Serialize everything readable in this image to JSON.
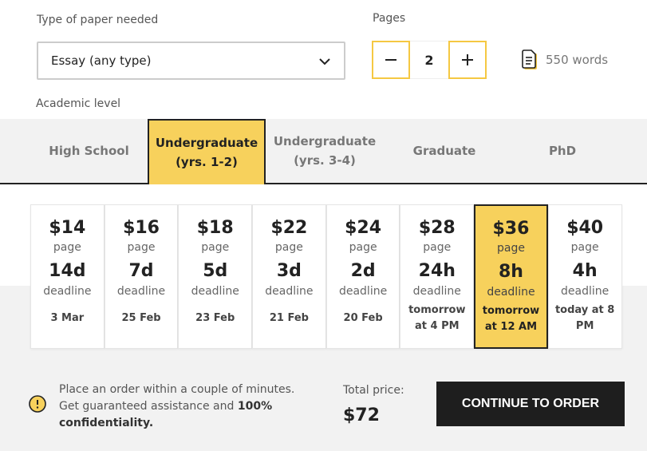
{
  "paper_type": {
    "label": "Type of paper needed",
    "value": "Essay (any type)"
  },
  "pages": {
    "label": "Pages",
    "value": "2",
    "minus_icon": "minus-icon",
    "plus_icon": "plus-icon"
  },
  "words": {
    "text": "550 words",
    "icon": "document-icon"
  },
  "academic_level": {
    "label": "Academic level",
    "levels": [
      {
        "line1": "High School",
        "line2": ""
      },
      {
        "line1": "Undergraduate",
        "line2": "(yrs. 1-2)"
      },
      {
        "line1": "Undergraduate",
        "line2": "(yrs. 3-4)"
      },
      {
        "line1": "Graduate",
        "line2": ""
      },
      {
        "line1": "PhD",
        "line2": ""
      }
    ],
    "selected": "Undergraduate (yrs. 1-2)"
  },
  "deadlines": [
    {
      "price": "$14",
      "unit": "page",
      "term": "14d",
      "label": "deadline",
      "date": "3 Mar"
    },
    {
      "price": "$16",
      "unit": "page",
      "term": "7d",
      "label": "deadline",
      "date": "25 Feb"
    },
    {
      "price": "$18",
      "unit": "page",
      "term": "5d",
      "label": "deadline",
      "date": "23 Feb"
    },
    {
      "price": "$22",
      "unit": "page",
      "term": "3d",
      "label": "deadline",
      "date": "21 Feb"
    },
    {
      "price": "$24",
      "unit": "page",
      "term": "2d",
      "label": "deadline",
      "date": "20 Feb"
    },
    {
      "price": "$28",
      "unit": "page",
      "term": "24h",
      "label": "deadline",
      "date": "tomorrow at 4 PM"
    },
    {
      "price": "$36",
      "unit": "page",
      "term": "8h",
      "label": "deadline",
      "date": "tomorrow at 12 AM"
    },
    {
      "price": "$40",
      "unit": "page",
      "term": "4h",
      "label": "deadline",
      "date": "today at 8 PM"
    }
  ],
  "selected_deadline": "8h",
  "info": {
    "icon": "info-icon",
    "text_part1": "Place an order within a couple of minutes. Get guaranteed assistance and ",
    "text_bold": "100% confidentiality."
  },
  "total": {
    "label": "Total price:",
    "value": "$72"
  },
  "cta": {
    "label": "CONTINUE TO ORDER"
  },
  "colors": {
    "accent": "#f7d15c",
    "dark": "#1e1e1e",
    "panel": "#f2f2f2"
  }
}
